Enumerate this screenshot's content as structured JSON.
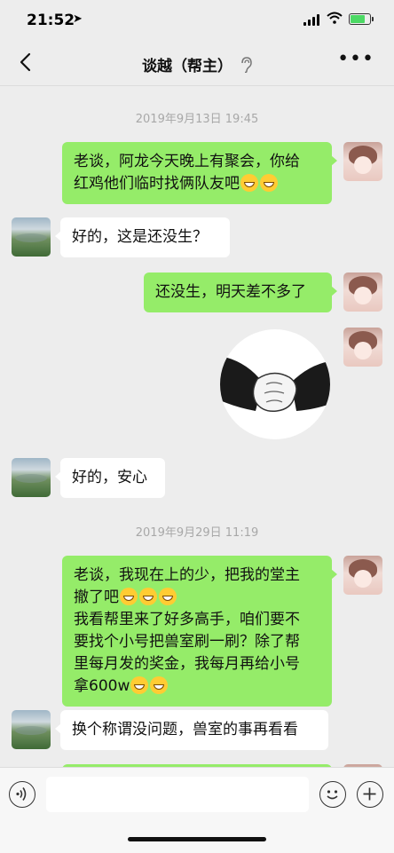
{
  "status": {
    "time": "21:52"
  },
  "nav": {
    "title": "谈越（帮主）"
  },
  "messages": {
    "ts1": "2019年9月13日 19:45",
    "m1_line1": "老谈，阿龙今天晚上有聚会，你给",
    "m1_line2": "红鸡他们临时找俩队友吧",
    "m2": "好的，这是还没生？",
    "m3": "还没生，明天差不多了",
    "m5": "好的，安心",
    "ts2": "2019年9月29日 11:19",
    "m6_line1": "老谈，我现在上的少，把我的堂主",
    "m6_line2": "撤了吧",
    "m6_line3": "我看帮里来了好多高手，咱们要不",
    "m6_line4": "要找个小号把兽室刷一刷？除了帮",
    "m6_line5": "里每月发的奖金，我每月再给小号",
    "m6_line6": "拿600w",
    "m7": "换个称谓没问题，兽室的事再看看"
  },
  "icons": {
    "back": "chevron-left-icon",
    "ear": "ear-icon",
    "more": "more-icon",
    "voice": "voice-icon",
    "emoji": "emoji-icon",
    "plus": "plus-icon",
    "grin": "grin-emoji"
  },
  "colors": {
    "self_bubble": "#95ec69",
    "other_bubble": "#ffffff",
    "background": "#ededed"
  }
}
